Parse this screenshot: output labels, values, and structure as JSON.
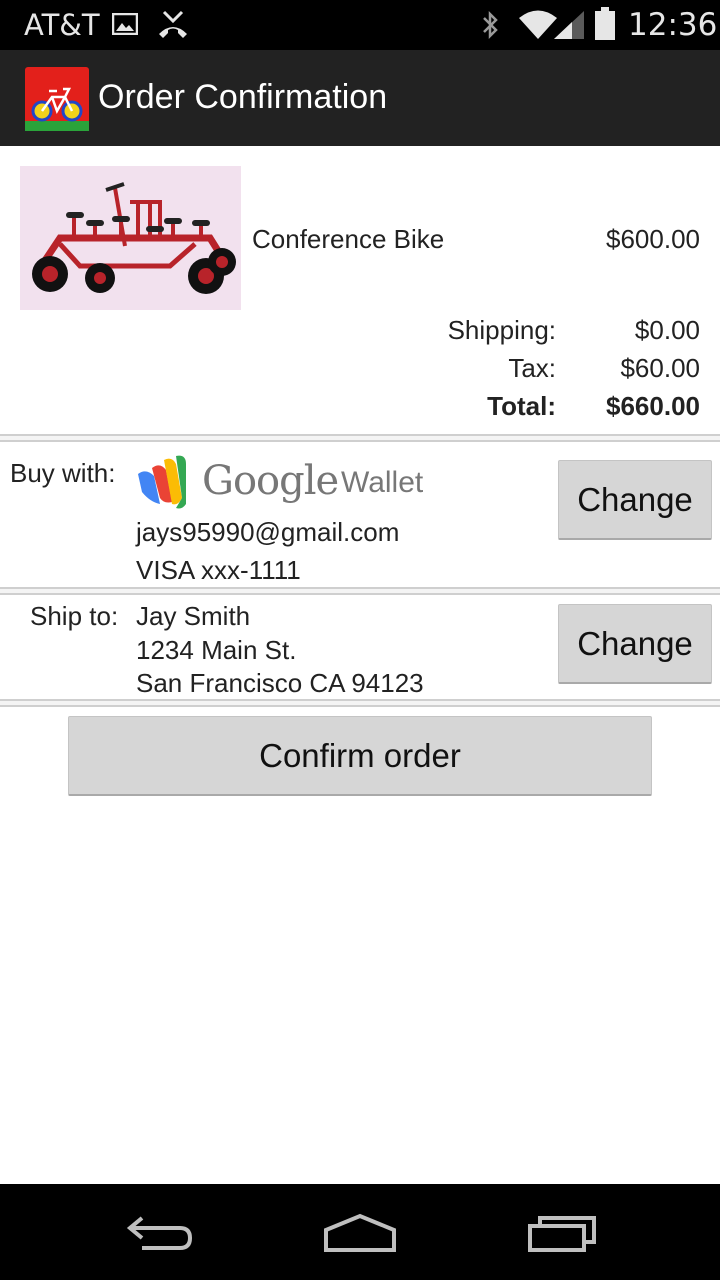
{
  "status_bar": {
    "carrier": "AT&T",
    "time": "12:36",
    "icons": [
      "image-icon",
      "missed-call-icon",
      "bluetooth-icon",
      "wifi-icon",
      "signal-icon",
      "battery-icon"
    ]
  },
  "action_bar": {
    "title": "Order Confirmation",
    "logo_icon": "bike-app-logo-icon"
  },
  "order": {
    "item_name": "Conference Bike",
    "item_price": "$600.00",
    "shipping_label": "Shipping:",
    "shipping_value": "$0.00",
    "tax_label": "Tax:",
    "tax_value": "$60.00",
    "total_label": "Total:",
    "total_value": "$660.00"
  },
  "payment": {
    "label": "Buy with:",
    "wallet_brand": "Google",
    "wallet_product": "Wallet",
    "email": "jays95990@gmail.com",
    "card": "VISA xxx-1111",
    "change_label": "Change"
  },
  "shipping": {
    "label": "Ship to:",
    "name": "Jay Smith",
    "street": "1234 Main St.",
    "city": "San Francisco CA 94123",
    "change_label": "Change"
  },
  "confirm_label": "Confirm order",
  "nav_bar": {
    "icons": [
      "back-icon",
      "home-icon",
      "recent-apps-icon"
    ]
  },
  "colors": {
    "status_bar": "#000000",
    "action_bar": "#222222",
    "button": "#d6d6d6",
    "product_bg": "#f2e1ee",
    "bike_red": "#b8232a"
  }
}
